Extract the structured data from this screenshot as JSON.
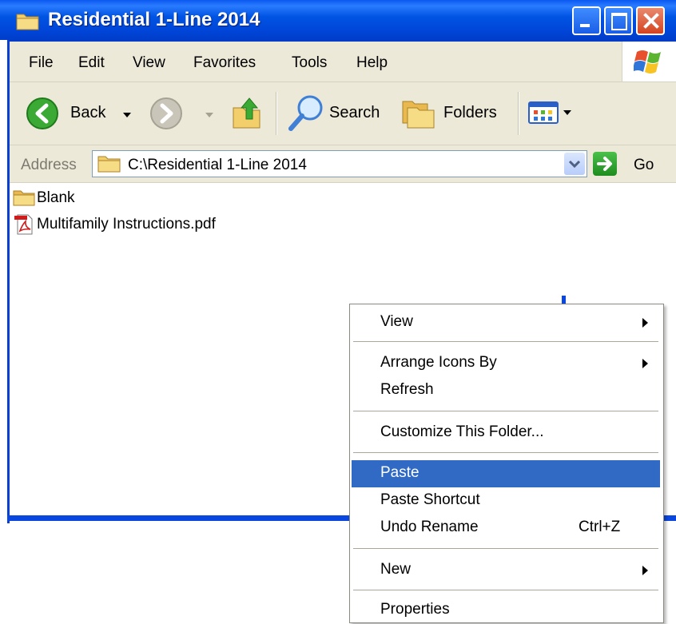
{
  "window": {
    "title": "Residential 1-Line 2014",
    "caption_buttons": [
      "minimize",
      "maximize",
      "close"
    ]
  },
  "menubar": {
    "items": [
      "File",
      "Edit",
      "View",
      "Favorites",
      "Tools",
      "Help"
    ]
  },
  "toolbar": {
    "back_label": "Back",
    "search_label": "Search",
    "folders_label": "Folders"
  },
  "address": {
    "label": "Address",
    "path": "C:\\Residential 1-Line 2014",
    "go_label": "Go"
  },
  "files": [
    {
      "name": "Blank",
      "icon": "folder-icon"
    },
    {
      "name": "Multifamily Instructions.pdf",
      "icon": "pdf-icon"
    }
  ],
  "context_menu": {
    "view": "View",
    "arrange_icons_by": "Arrange Icons By",
    "refresh": "Refresh",
    "customize": "Customize This Folder...",
    "paste": "Paste",
    "paste_shortcut": "Paste Shortcut",
    "undo_rename": "Undo Rename",
    "undo_rename_shortcut": "Ctrl+Z",
    "new": "New",
    "properties": "Properties",
    "highlighted_item": "Paste"
  },
  "colors": {
    "titlebar": "#0054e3",
    "menu_highlight": "#316ac5",
    "chrome": "#ece9d8"
  }
}
